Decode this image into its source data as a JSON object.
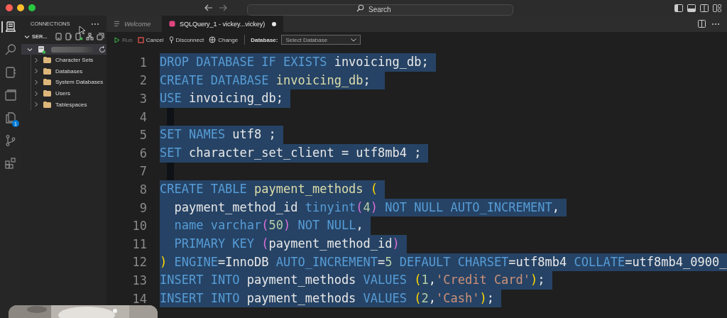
{
  "titlebar": {
    "search": {
      "placeholder": "Search"
    }
  },
  "activity_bar": [
    {
      "kind": "server",
      "selected": true
    },
    {
      "kind": "search",
      "selected": false
    },
    {
      "kind": "notebook",
      "selected": false
    },
    {
      "kind": "windows",
      "selected": false
    },
    {
      "kind": "files",
      "selected": false,
      "badge": "1"
    },
    {
      "kind": "branch",
      "selected": false
    },
    {
      "kind": "extensions",
      "selected": false
    }
  ],
  "sidebar": {
    "title": "CONNECTIONS",
    "section": {
      "label": "SER...",
      "expanded": true
    },
    "server": {
      "expanded": true,
      "connected": true,
      "children": [
        {
          "label": "Character Sets",
          "expanded": false
        },
        {
          "label": "Databases",
          "expanded": false
        },
        {
          "label": "System Databases",
          "expanded": false
        },
        {
          "label": "Users",
          "expanded": false
        },
        {
          "label": "Tablespaces",
          "expanded": false
        }
      ]
    }
  },
  "tabs": [
    {
      "label": "Welcome",
      "selected": false,
      "dirty": false
    },
    {
      "label": "SQLQuery_1 - vickey...vickey)",
      "selected": true,
      "dirty": true
    }
  ],
  "toolbar": {
    "buttons": [
      {
        "kind": "run",
        "label": "Run",
        "disabled": true
      },
      {
        "kind": "cancel",
        "label": "Cancel",
        "disabled": false
      },
      {
        "kind": "disconnect",
        "label": "Disconnect",
        "disabled": false
      },
      {
        "kind": "change",
        "label": "Change",
        "disabled": false
      }
    ],
    "database_label": "Database:",
    "database_select": {
      "placeholder": "Select Database"
    }
  },
  "editor": {
    "lines": [
      {
        "number": "1",
        "selected": true,
        "tokens": [
          {
            "kind": "kw",
            "text": "DROP DATABASE IF EXISTS"
          },
          {
            "kind": "id",
            "text": " invoicing_db;"
          }
        ]
      },
      {
        "number": "2",
        "selected": true,
        "tokens": [
          {
            "kind": "kw",
            "text": "CREATE DATABASE"
          },
          {
            "kind": "fn",
            "text": " invoicing_db"
          },
          {
            "kind": "id",
            "text": "; "
          }
        ]
      },
      {
        "number": "3",
        "selected": true,
        "tokens": [
          {
            "kind": "kw",
            "text": "USE"
          },
          {
            "kind": "id",
            "text": " invoicing_db;"
          }
        ]
      },
      {
        "number": "4",
        "selected": true
      },
      {
        "number": "5",
        "selected": true,
        "tokens": [
          {
            "kind": "kw",
            "text": "SET NAMES"
          },
          {
            "kind": "id",
            "text": " utf8 ;"
          }
        ]
      },
      {
        "number": "6",
        "selected": true,
        "tokens": [
          {
            "kind": "kw",
            "text": "SET"
          },
          {
            "kind": "id",
            "text": " character_set_client = utf8mb4 ;"
          }
        ]
      },
      {
        "number": "7",
        "selected": true
      },
      {
        "number": "8",
        "selected": true,
        "tokens": [
          {
            "kind": "kw",
            "text": "CREATE TABLE"
          },
          {
            "kind": "fn",
            "text": " payment_methods"
          },
          {
            "kind": "paren",
            "text": " ("
          }
        ]
      },
      {
        "number": "9",
        "selected": true,
        "tokens": [
          {
            "kind": "id",
            "text": "  payment_method_id"
          },
          {
            "kind": "kw",
            "text": " tinyint"
          },
          {
            "kind": "paren2",
            "text": "("
          },
          {
            "kind": "num",
            "text": "4"
          },
          {
            "kind": "paren2",
            "text": ")"
          },
          {
            "kind": "kw",
            "text": " NOT NULL AUTO_INCREMENT"
          },
          {
            "kind": "id",
            "text": ","
          }
        ]
      },
      {
        "number": "10",
        "selected": true,
        "tokens": [
          {
            "kind": "kw",
            "text": "  name varchar"
          },
          {
            "kind": "paren2",
            "text": "("
          },
          {
            "kind": "num",
            "text": "50"
          },
          {
            "kind": "paren2",
            "text": ")"
          },
          {
            "kind": "kw",
            "text": " NOT NULL"
          },
          {
            "kind": "id",
            "text": ","
          }
        ]
      },
      {
        "number": "11",
        "selected": true,
        "tokens": [
          {
            "kind": "kw",
            "text": "  PRIMARY KEY"
          },
          {
            "kind": "paren2",
            "text": " ("
          },
          {
            "kind": "id",
            "text": "payment_method_id"
          },
          {
            "kind": "paren2",
            "text": ")"
          }
        ]
      },
      {
        "number": "12",
        "selected": true,
        "tokens": [
          {
            "kind": "paren",
            "text": ")"
          },
          {
            "kind": "kw",
            "text": " ENGINE"
          },
          {
            "kind": "id",
            "text": "=InnoDB"
          },
          {
            "kind": "kw",
            "text": " AUTO_INCREMENT"
          },
          {
            "kind": "id",
            "text": "="
          },
          {
            "kind": "num",
            "text": "5"
          },
          {
            "kind": "kw",
            "text": " DEFAULT CHARSET"
          },
          {
            "kind": "id",
            "text": "=utf8mb4"
          },
          {
            "kind": "kw",
            "text": " COLLATE"
          },
          {
            "kind": "id",
            "text": "=utf8mb4_0900_"
          }
        ]
      },
      {
        "number": "13",
        "selected": true,
        "tokens": [
          {
            "kind": "kw",
            "text": "INSERT INTO"
          },
          {
            "kind": "id",
            "text": " payment_methods"
          },
          {
            "kind": "kw",
            "text": " VALUES"
          },
          {
            "kind": "paren",
            "text": " ("
          },
          {
            "kind": "num",
            "text": "1"
          },
          {
            "kind": "id",
            "text": ","
          },
          {
            "kind": "str",
            "text": "'Credit Card'"
          },
          {
            "kind": "paren",
            "text": ")"
          },
          {
            "kind": "id",
            "text": ";"
          }
        ]
      },
      {
        "number": "14",
        "selected": true,
        "tokens": [
          {
            "kind": "kw",
            "text": "INSERT INTO"
          },
          {
            "kind": "id",
            "text": " payment_methods"
          },
          {
            "kind": "kw",
            "text": " VALUES"
          },
          {
            "kind": "paren",
            "text": " ("
          },
          {
            "kind": "num",
            "text": "2"
          },
          {
            "kind": "id",
            "text": ","
          },
          {
            "kind": "str",
            "text": "'Cash'"
          },
          {
            "kind": "paren",
            "text": ")"
          },
          {
            "kind": "id",
            "text": ";"
          }
        ]
      }
    ]
  }
}
